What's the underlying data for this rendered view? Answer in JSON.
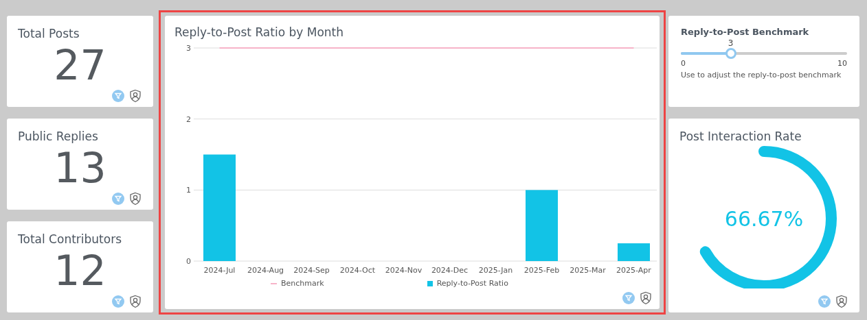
{
  "kpis": [
    {
      "title": "Total Posts",
      "value": "27"
    },
    {
      "title": "Public Replies",
      "value": "13"
    },
    {
      "title": "Total Contributors",
      "value": "12"
    }
  ],
  "ratio_chart": {
    "selected": true,
    "title": "Reply-to-Post Ratio by Month",
    "chart_data": {
      "type": "bar",
      "categories": [
        "2024-Jul",
        "2024-Aug",
        "2024-Sep",
        "2024-Oct",
        "2024-Nov",
        "2024-Dec",
        "2025-Jan",
        "2025-Feb",
        "2025-Mar",
        "2025-Apr"
      ],
      "ylim": [
        0,
        3
      ],
      "yticks": [
        0,
        1,
        2,
        3
      ],
      "series": [
        {
          "name": "Benchmark",
          "type": "line",
          "color": "#f7b3c8",
          "values": [
            3,
            3,
            3,
            3,
            3,
            3,
            3,
            3,
            3,
            3
          ]
        },
        {
          "name": "Reply-to-Post Ratio",
          "type": "bar",
          "color": "#12c3e6",
          "values": [
            1.5,
            0,
            0,
            0,
            0,
            0,
            0,
            1,
            0,
            0.25
          ]
        }
      ]
    }
  },
  "benchmark": {
    "title": "Reply-to-Post Benchmark",
    "value": "3",
    "level": 0.3,
    "min": "0",
    "max": "10",
    "caption": "Use to adjust the reply-to-post benchmark"
  },
  "gauge": {
    "title": "Post Interaction Rate",
    "value": "66.67%",
    "level": 0.6667
  }
}
